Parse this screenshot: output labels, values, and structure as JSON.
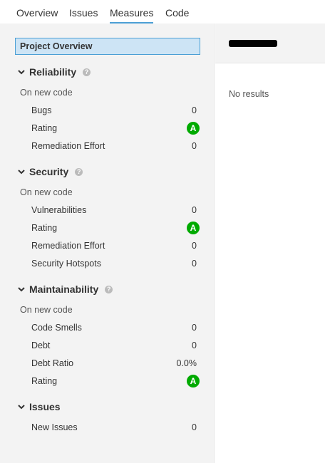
{
  "tabs": [
    "Overview",
    "Issues",
    "Measures",
    "Code"
  ],
  "active_tab": "Measures",
  "sidebar": {
    "project_overview": "Project Overview",
    "help_glyph": "?",
    "reliability": {
      "title": "Reliability",
      "subhead": "On new code",
      "metrics": [
        {
          "label": "Bugs",
          "value": "0"
        },
        {
          "label": "Rating",
          "value": "A"
        },
        {
          "label": "Remediation Effort",
          "value": "0"
        }
      ]
    },
    "security": {
      "title": "Security",
      "subhead": "On new code",
      "metrics": [
        {
          "label": "Vulnerabilities",
          "value": "0"
        },
        {
          "label": "Rating",
          "value": "A"
        },
        {
          "label": "Remediation Effort",
          "value": "0"
        },
        {
          "label": "Security Hotspots",
          "value": "0"
        }
      ]
    },
    "maintainability": {
      "title": "Maintainability",
      "subhead": "On new code",
      "metrics": [
        {
          "label": "Code Smells",
          "value": "0"
        },
        {
          "label": "Debt",
          "value": "0"
        },
        {
          "label": "Debt Ratio",
          "value": "0.0%"
        },
        {
          "label": "Rating",
          "value": "A"
        }
      ]
    },
    "issues": {
      "title": "Issues",
      "metrics": [
        {
          "label": "New Issues",
          "value": "0"
        }
      ]
    }
  },
  "main": {
    "no_results": "No results"
  },
  "colors": {
    "accent": "#4b9fd5",
    "rating_a": "#00aa00",
    "selected_bg": "#cde4f5"
  }
}
